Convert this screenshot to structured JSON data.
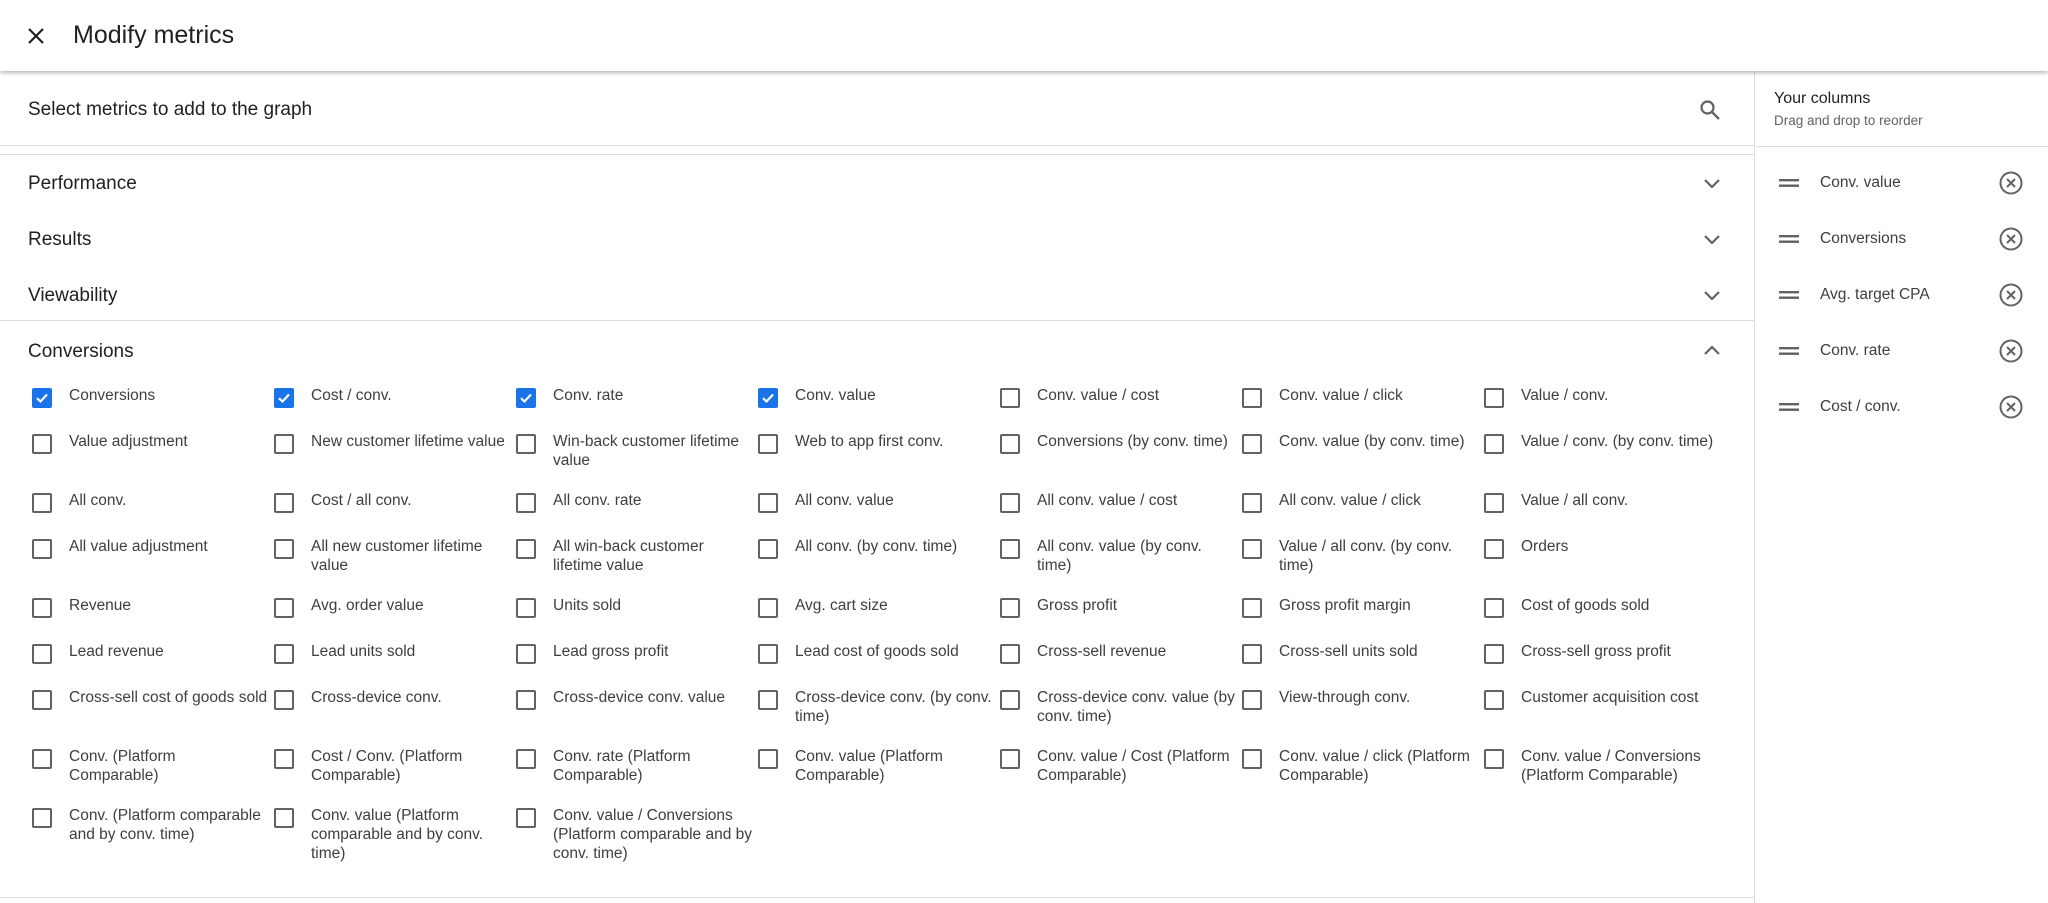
{
  "header": {
    "title": "Modify metrics",
    "close_icon": "close-icon"
  },
  "main": {
    "title": "Select metrics to add to the graph",
    "search_icon": "search-icon",
    "sections": [
      {
        "label": "Performance",
        "expanded": false
      },
      {
        "label": "Results",
        "expanded": false
      },
      {
        "label": "Viewability",
        "expanded": false
      },
      {
        "label": "Conversions",
        "expanded": true
      }
    ],
    "conversions_rows": [
      [
        {
          "label": "Conversions",
          "checked": true
        },
        {
          "label": "Cost / conv.",
          "checked": true
        },
        {
          "label": "Conv. rate",
          "checked": true
        },
        {
          "label": "Conv. value",
          "checked": true
        },
        {
          "label": "Conv. value / cost",
          "checked": false
        },
        {
          "label": "Conv. value / click",
          "checked": false
        },
        {
          "label": "Value / conv.",
          "checked": false
        }
      ],
      [
        {
          "label": "Value adjustment",
          "checked": false
        },
        {
          "label": "New customer lifetime value",
          "checked": false
        },
        {
          "label": "Win-back customer lifetime value",
          "checked": false
        },
        {
          "label": "Web to app first conv.",
          "checked": false
        },
        {
          "label": "Conversions (by conv. time)",
          "checked": false
        },
        {
          "label": "Conv. value (by conv. time)",
          "checked": false
        },
        {
          "label": "Value / conv. (by conv. time)",
          "checked": false
        }
      ],
      [
        {
          "label": "All conv.",
          "checked": false
        },
        {
          "label": "Cost / all conv.",
          "checked": false
        },
        {
          "label": "All conv. rate",
          "checked": false
        },
        {
          "label": "All conv. value",
          "checked": false
        },
        {
          "label": "All conv. value / cost",
          "checked": false
        },
        {
          "label": "All conv. value / click",
          "checked": false
        },
        {
          "label": "Value / all conv.",
          "checked": false
        }
      ],
      [
        {
          "label": "All value adjustment",
          "checked": false
        },
        {
          "label": "All new customer lifetime value",
          "checked": false
        },
        {
          "label": "All win-back customer lifetime value",
          "checked": false
        },
        {
          "label": "All conv. (by conv. time)",
          "checked": false
        },
        {
          "label": "All conv. value (by conv. time)",
          "checked": false
        },
        {
          "label": "Value / all conv. (by conv. time)",
          "checked": false
        },
        {
          "label": "Orders",
          "checked": false
        }
      ],
      [
        {
          "label": "Revenue",
          "checked": false
        },
        {
          "label": "Avg. order value",
          "checked": false
        },
        {
          "label": "Units sold",
          "checked": false
        },
        {
          "label": "Avg. cart size",
          "checked": false
        },
        {
          "label": "Gross profit",
          "checked": false
        },
        {
          "label": "Gross profit margin",
          "checked": false
        },
        {
          "label": "Cost of goods sold",
          "checked": false
        }
      ],
      [
        {
          "label": "Lead revenue",
          "checked": false
        },
        {
          "label": "Lead units sold",
          "checked": false
        },
        {
          "label": "Lead gross profit",
          "checked": false
        },
        {
          "label": "Lead cost of goods sold",
          "checked": false
        },
        {
          "label": "Cross-sell revenue",
          "checked": false
        },
        {
          "label": "Cross-sell units sold",
          "checked": false
        },
        {
          "label": "Cross-sell gross profit",
          "checked": false
        }
      ],
      [
        {
          "label": "Cross-sell cost of goods sold",
          "checked": false
        },
        {
          "label": "Cross-device conv.",
          "checked": false
        },
        {
          "label": "Cross-device conv. value",
          "checked": false
        },
        {
          "label": "Cross-device conv. (by conv. time)",
          "checked": false
        },
        {
          "label": "Cross-device conv. value (by conv. time)",
          "checked": false
        },
        {
          "label": "View-through conv.",
          "checked": false
        },
        {
          "label": "Customer acquisition cost",
          "checked": false
        }
      ],
      [
        {
          "label": "Conv. (Platform Comparable)",
          "checked": false
        },
        {
          "label": "Cost / Conv. (Platform Comparable)",
          "checked": false
        },
        {
          "label": "Conv. rate (Platform Comparable)",
          "checked": false
        },
        {
          "label": "Conv. value (Platform Comparable)",
          "checked": false
        },
        {
          "label": "Conv. value / Cost (Platform Comparable)",
          "checked": false
        },
        {
          "label": "Conv. value / click (Platform Comparable)",
          "checked": false
        },
        {
          "label": "Conv. value / Conversions (Platform Comparable)",
          "checked": false
        }
      ],
      [
        {
          "label": "Conv. (Platform comparable and by conv. time)",
          "checked": false
        },
        {
          "label": "Conv. value (Platform comparable and by conv. time)",
          "checked": false
        },
        {
          "label": "Conv. value / Conversions (Platform comparable and by conv. time)",
          "checked": false
        }
      ]
    ]
  },
  "side": {
    "title": "Your columns",
    "subtitle": "Drag and drop to reorder",
    "columns": [
      {
        "label": "Conv. value"
      },
      {
        "label": "Conversions"
      },
      {
        "label": "Avg. target CPA"
      },
      {
        "label": "Conv. rate"
      },
      {
        "label": "Cost / conv."
      }
    ]
  },
  "colors": {
    "accent": "#1a73e8",
    "text": "#202124",
    "secondary": "#5f6368",
    "divider": "#dadce0"
  }
}
